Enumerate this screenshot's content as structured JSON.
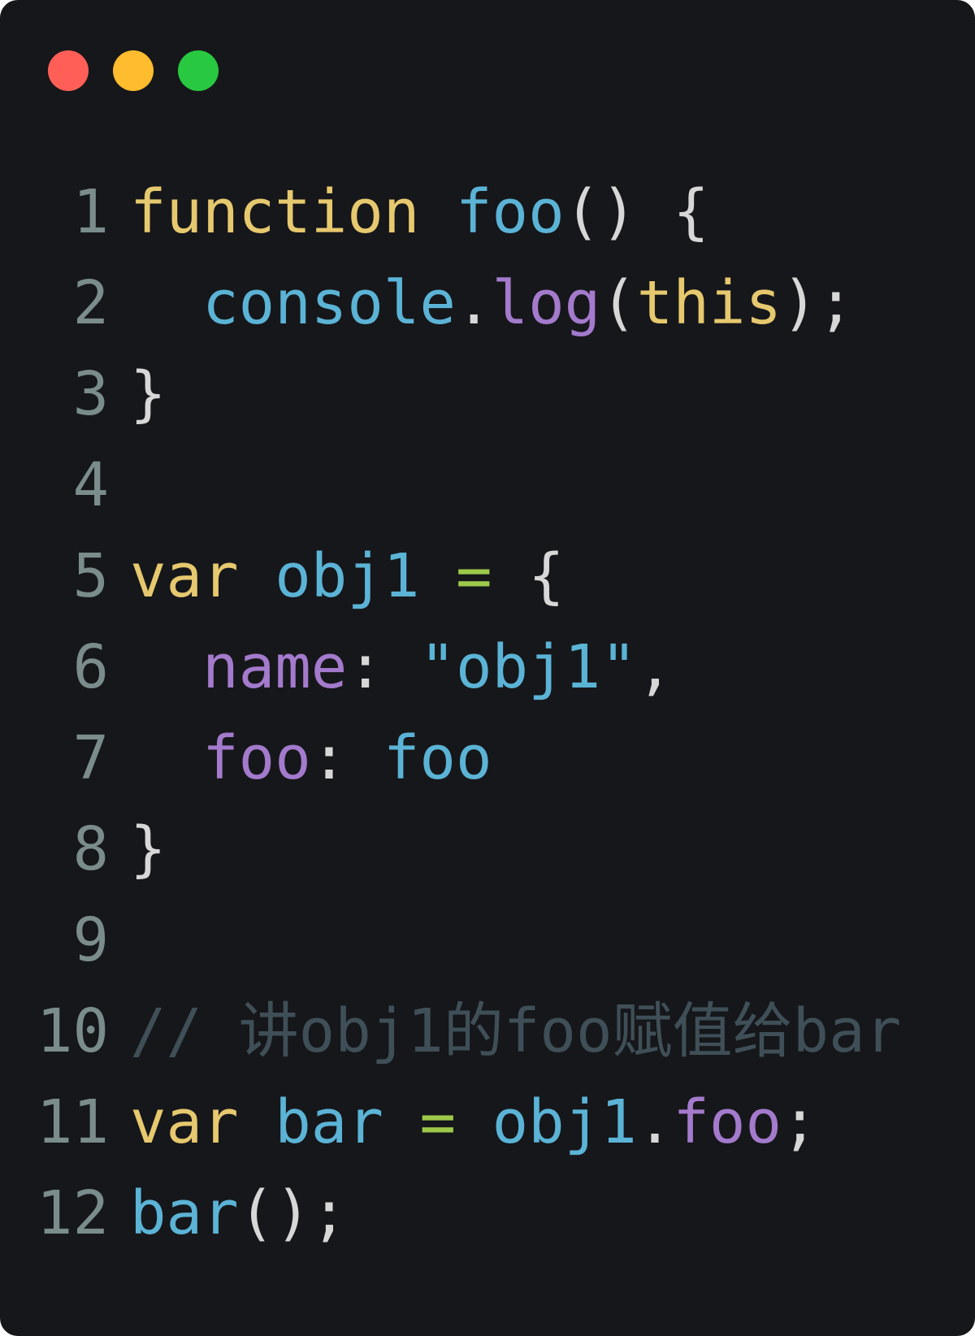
{
  "window": {
    "background": "#16171a",
    "controls": [
      {
        "name": "close-dot",
        "color": "#ff5f57"
      },
      {
        "name": "minimize-dot",
        "color": "#febc2e"
      },
      {
        "name": "zoom-dot",
        "color": "#28c840"
      }
    ]
  },
  "colors": {
    "line_number": "#7a8c8c",
    "keyword": "#e6c86e",
    "identifier": "#5bb3d6",
    "property": "#a37acc",
    "punctuation": "#d7d7d7",
    "operator": "#9dc94a",
    "comment": "#3f4f57"
  },
  "code": {
    "lines": [
      {
        "number": "1",
        "tokens": [
          {
            "text": "function",
            "kind": "keyword"
          },
          {
            "text": " ",
            "kind": "punctuation"
          },
          {
            "text": "foo",
            "kind": "identifier"
          },
          {
            "text": "() {",
            "kind": "punctuation"
          }
        ]
      },
      {
        "number": "2",
        "tokens": [
          {
            "text": "  ",
            "kind": "punctuation"
          },
          {
            "text": "console",
            "kind": "identifier"
          },
          {
            "text": ".",
            "kind": "punctuation"
          },
          {
            "text": "log",
            "kind": "property"
          },
          {
            "text": "(",
            "kind": "punctuation"
          },
          {
            "text": "this",
            "kind": "keyword"
          },
          {
            "text": ");",
            "kind": "punctuation"
          }
        ]
      },
      {
        "number": "3",
        "tokens": [
          {
            "text": "}",
            "kind": "punctuation"
          }
        ]
      },
      {
        "number": "4",
        "tokens": []
      },
      {
        "number": "5",
        "tokens": [
          {
            "text": "var",
            "kind": "keyword"
          },
          {
            "text": " ",
            "kind": "punctuation"
          },
          {
            "text": "obj1",
            "kind": "identifier"
          },
          {
            "text": " ",
            "kind": "punctuation"
          },
          {
            "text": "=",
            "kind": "operator"
          },
          {
            "text": " {",
            "kind": "punctuation"
          }
        ]
      },
      {
        "number": "6",
        "tokens": [
          {
            "text": "  ",
            "kind": "punctuation"
          },
          {
            "text": "name",
            "kind": "property"
          },
          {
            "text": ": ",
            "kind": "punctuation"
          },
          {
            "text": "\"obj1\"",
            "kind": "identifier"
          },
          {
            "text": ",",
            "kind": "punctuation"
          }
        ]
      },
      {
        "number": "7",
        "tokens": [
          {
            "text": "  ",
            "kind": "punctuation"
          },
          {
            "text": "foo",
            "kind": "property"
          },
          {
            "text": ": ",
            "kind": "punctuation"
          },
          {
            "text": "foo",
            "kind": "identifier"
          }
        ]
      },
      {
        "number": "8",
        "tokens": [
          {
            "text": "}",
            "kind": "punctuation"
          }
        ]
      },
      {
        "number": "9",
        "tokens": []
      },
      {
        "number": "10",
        "tokens": [
          {
            "text": "// 讲obj1的foo赋值给bar",
            "kind": "comment"
          }
        ]
      },
      {
        "number": "11",
        "tokens": [
          {
            "text": "var",
            "kind": "keyword"
          },
          {
            "text": " ",
            "kind": "punctuation"
          },
          {
            "text": "bar",
            "kind": "identifier"
          },
          {
            "text": " ",
            "kind": "punctuation"
          },
          {
            "text": "=",
            "kind": "operator"
          },
          {
            "text": " ",
            "kind": "punctuation"
          },
          {
            "text": "obj1",
            "kind": "identifier"
          },
          {
            "text": ".",
            "kind": "punctuation"
          },
          {
            "text": "foo",
            "kind": "property"
          },
          {
            "text": ";",
            "kind": "punctuation"
          }
        ]
      },
      {
        "number": "12",
        "tokens": [
          {
            "text": "bar",
            "kind": "identifier"
          },
          {
            "text": "();",
            "kind": "punctuation"
          }
        ]
      }
    ]
  }
}
